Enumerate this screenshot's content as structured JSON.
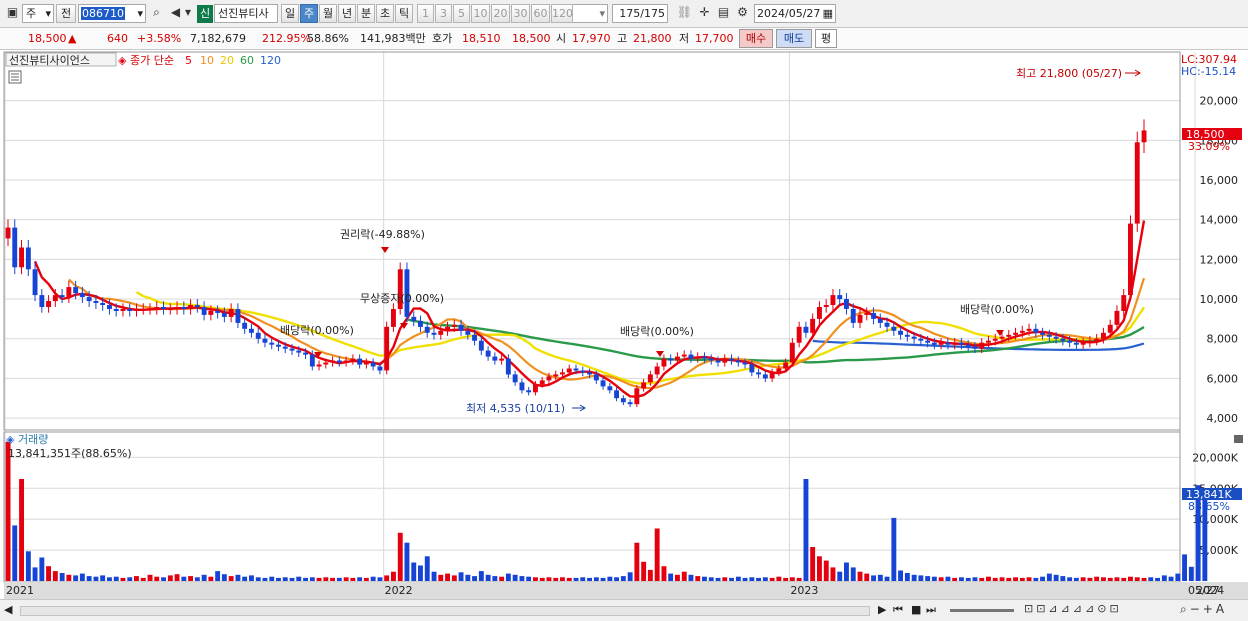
{
  "toolbar": {
    "period_select": "주",
    "prev_label": "전",
    "code": "086710",
    "credit_badge": "신",
    "stock_name": "선진뷰티사",
    "periods": [
      "일",
      "주",
      "월",
      "년",
      "분",
      "초",
      "틱"
    ],
    "active_period": "주",
    "intervals": [
      "1",
      "3",
      "5",
      "10",
      "20",
      "30",
      "60",
      "120"
    ],
    "count": "175",
    "count_total": "/175",
    "date": "2024/05/27",
    "icons": [
      "chart-type-icon",
      "dropdown-icon",
      "search-icon",
      "speaker-icon",
      "link-icon",
      "crosshair-icon",
      "save-icon",
      "gear-icon",
      "calendar-icon"
    ]
  },
  "quote": {
    "price": "18,500",
    "change_arrow": "▲",
    "change": "640",
    "change_pct": "+3.58%",
    "volume": "7,182,679",
    "vol_ratio": "212.95%",
    "turnover": "58.86%",
    "amount": "141,983백만",
    "ask_label": "호가",
    "ask": "18,510",
    "bid": "18,500",
    "open_label": "시",
    "open": "17,970",
    "high_label": "고",
    "high": "21,800",
    "low_label": "저",
    "low": "17,700",
    "buy_button": "매수",
    "sell_button": "매도",
    "avg_button": "평"
  },
  "colors": {
    "up": "#e4000f",
    "down": "#1645d6",
    "ma5": "#e8000b",
    "ma10": "#f09020",
    "ma20": "#f0e000",
    "ma60": "#2a9a4a",
    "ma120": "#2860d0",
    "axis_bg": "#ffffff",
    "grid": "#d8d8d8"
  },
  "legend": {
    "name": "선진뷰티사이언스",
    "prefix": "종가 단순",
    "ma": [
      "5",
      "10",
      "20",
      "60",
      "120"
    ]
  },
  "right_labels": {
    "lc": "LC:307.94",
    "hc": "HC:-15.14",
    "price_tag": "18,500",
    "price_pct": "33.09%",
    "vol_tag": "13,841K",
    "vol_pct": "88.65%",
    "date_tag": "05/27"
  },
  "annotations": {
    "high": "최고 21,800 (05/27)",
    "low": "최저 4,535 (10/11)",
    "rights": "권리락(-49.88%)",
    "bonus": "무상증자(0.00%)",
    "div1": "배당락(0.00%)",
    "div2": "배당락(0.00%)",
    "div3": "배당락(0.00%)"
  },
  "volume_panel": {
    "title": "거래량",
    "value": "13,841,351주(88.65%)"
  },
  "chart_data": [
    {
      "type": "candlestick",
      "title": "선진뷰티사이언스",
      "interval": "weekly",
      "yticks": [
        4000,
        6000,
        8000,
        10000,
        12000,
        14000,
        16000,
        18000,
        20000
      ],
      "ytick_labels": [
        "4,000",
        "6,000",
        "8,000",
        "10,000",
        "12,000",
        "14,000",
        "16,000",
        "18,000",
        "20,000"
      ],
      "ylim": [
        3500,
        22300
      ],
      "xtick_labels": [
        "2021",
        "2022",
        "2023",
        "2024"
      ],
      "xtick_index": [
        0,
        56,
        116,
        176
      ],
      "series": [
        {
          "name": "price",
          "close": [
            13600,
            11600,
            12600,
            11500,
            10200,
            9600,
            9900,
            10200,
            10100,
            10600,
            10300,
            10100,
            9900,
            9800,
            9700,
            9500,
            9400,
            9500,
            9400,
            9500,
            9500,
            9500,
            9600,
            9500,
            9500,
            9600,
            9500,
            9700,
            9600,
            9200,
            9400,
            9300,
            9100,
            9500,
            8800,
            8500,
            8300,
            8000,
            7800,
            7700,
            7600,
            7500,
            7400,
            7300,
            7200,
            6600,
            6700,
            6800,
            6900,
            6800,
            6900,
            7000,
            6700,
            6800,
            6600,
            6400,
            8600,
            9500,
            11500,
            9100,
            8900,
            8600,
            8300,
            8200,
            8400,
            8600,
            8700,
            8400,
            8200,
            7900,
            7400,
            7100,
            6900,
            7000,
            6200,
            5800,
            5400,
            5300,
            5700,
            5900,
            6100,
            6200,
            6300,
            6500,
            6400,
            6300,
            6200,
            5900,
            5600,
            5400,
            5000,
            4800,
            4700,
            5500,
            5800,
            6200,
            6600,
            7000,
            6900,
            7100,
            7200,
            7000,
            7100,
            7000,
            6900,
            6800,
            7000,
            6900,
            6800,
            6700,
            6300,
            6200,
            6000,
            6300,
            6500,
            6800,
            7800,
            8600,
            8300,
            9000,
            9600,
            9700,
            10200,
            10000,
            9500,
            8800,
            9200,
            9300,
            9000,
            8800,
            8600,
            8400,
            8200,
            8100,
            8000,
            7900,
            7800,
            7700,
            7800,
            7700,
            7800,
            7700,
            7600,
            7500,
            7800,
            7900,
            8000,
            8100,
            8200,
            8300,
            8400,
            8500,
            8300,
            8200,
            8100,
            8000,
            7900,
            7800,
            7700,
            7800,
            7900,
            8000,
            8300,
            8700,
            9400,
            10200,
            13800,
            17900,
            18500
          ]
        },
        {
          "name": "MA 5",
          "label": "5"
        },
        {
          "name": "MA 10",
          "label": "10"
        },
        {
          "name": "MA 20",
          "label": "20"
        },
        {
          "name": "MA 60",
          "label": "60"
        },
        {
          "name": "MA 120",
          "label": "120"
        }
      ]
    },
    {
      "type": "bar",
      "title": "거래량",
      "yticks": [
        5000,
        10000,
        15000,
        20000
      ],
      "ytick_labels": [
        "5,000K",
        "10,000K",
        "15,000K",
        "20,000K"
      ],
      "ylim": [
        0,
        22000
      ],
      "unit": "K",
      "values": [
        22500,
        9000,
        16500,
        4800,
        2200,
        3800,
        2400,
        1600,
        1300,
        1000,
        900,
        1200,
        800,
        700,
        900,
        600,
        700,
        500,
        600,
        800,
        500,
        1000,
        700,
        600,
        900,
        1100,
        700,
        800,
        600,
        1000,
        700,
        1600,
        1100,
        800,
        1000,
        700,
        900,
        600,
        500,
        700,
        500,
        600,
        500,
        700,
        500,
        600,
        500,
        600,
        500,
        500,
        600,
        500,
        600,
        500,
        700,
        600,
        900,
        1500,
        7800,
        6200,
        3000,
        2500,
        4000,
        1500,
        1000,
        1200,
        900,
        1400,
        1000,
        800,
        1600,
        1000,
        800,
        700,
        1200,
        1000,
        800,
        700,
        600,
        500,
        600,
        500,
        600,
        500,
        500,
        600,
        500,
        600,
        500,
        700,
        600,
        800,
        1400,
        6200,
        3100,
        1800,
        8500,
        2400,
        1200,
        1000,
        1500,
        1000,
        800,
        700,
        600,
        500,
        600,
        500,
        700,
        500,
        600,
        500,
        600,
        500,
        700,
        500,
        600,
        500,
        16500,
        5500,
        4000,
        3300,
        2200,
        1500,
        3000,
        2200,
        1500,
        1200,
        900,
        1000,
        700,
        10200,
        1700,
        1300,
        1000,
        900,
        800,
        700,
        600,
        700,
        500,
        600,
        500,
        600,
        500,
        700,
        500,
        600,
        500,
        600,
        500,
        600,
        500,
        700,
        1200,
        1000,
        800,
        600,
        500,
        600,
        500,
        700,
        600,
        500,
        600,
        500,
        700,
        600,
        500,
        600,
        500,
        900,
        700,
        1200,
        4300,
        2300,
        15500,
        13841
      ]
    }
  ]
}
